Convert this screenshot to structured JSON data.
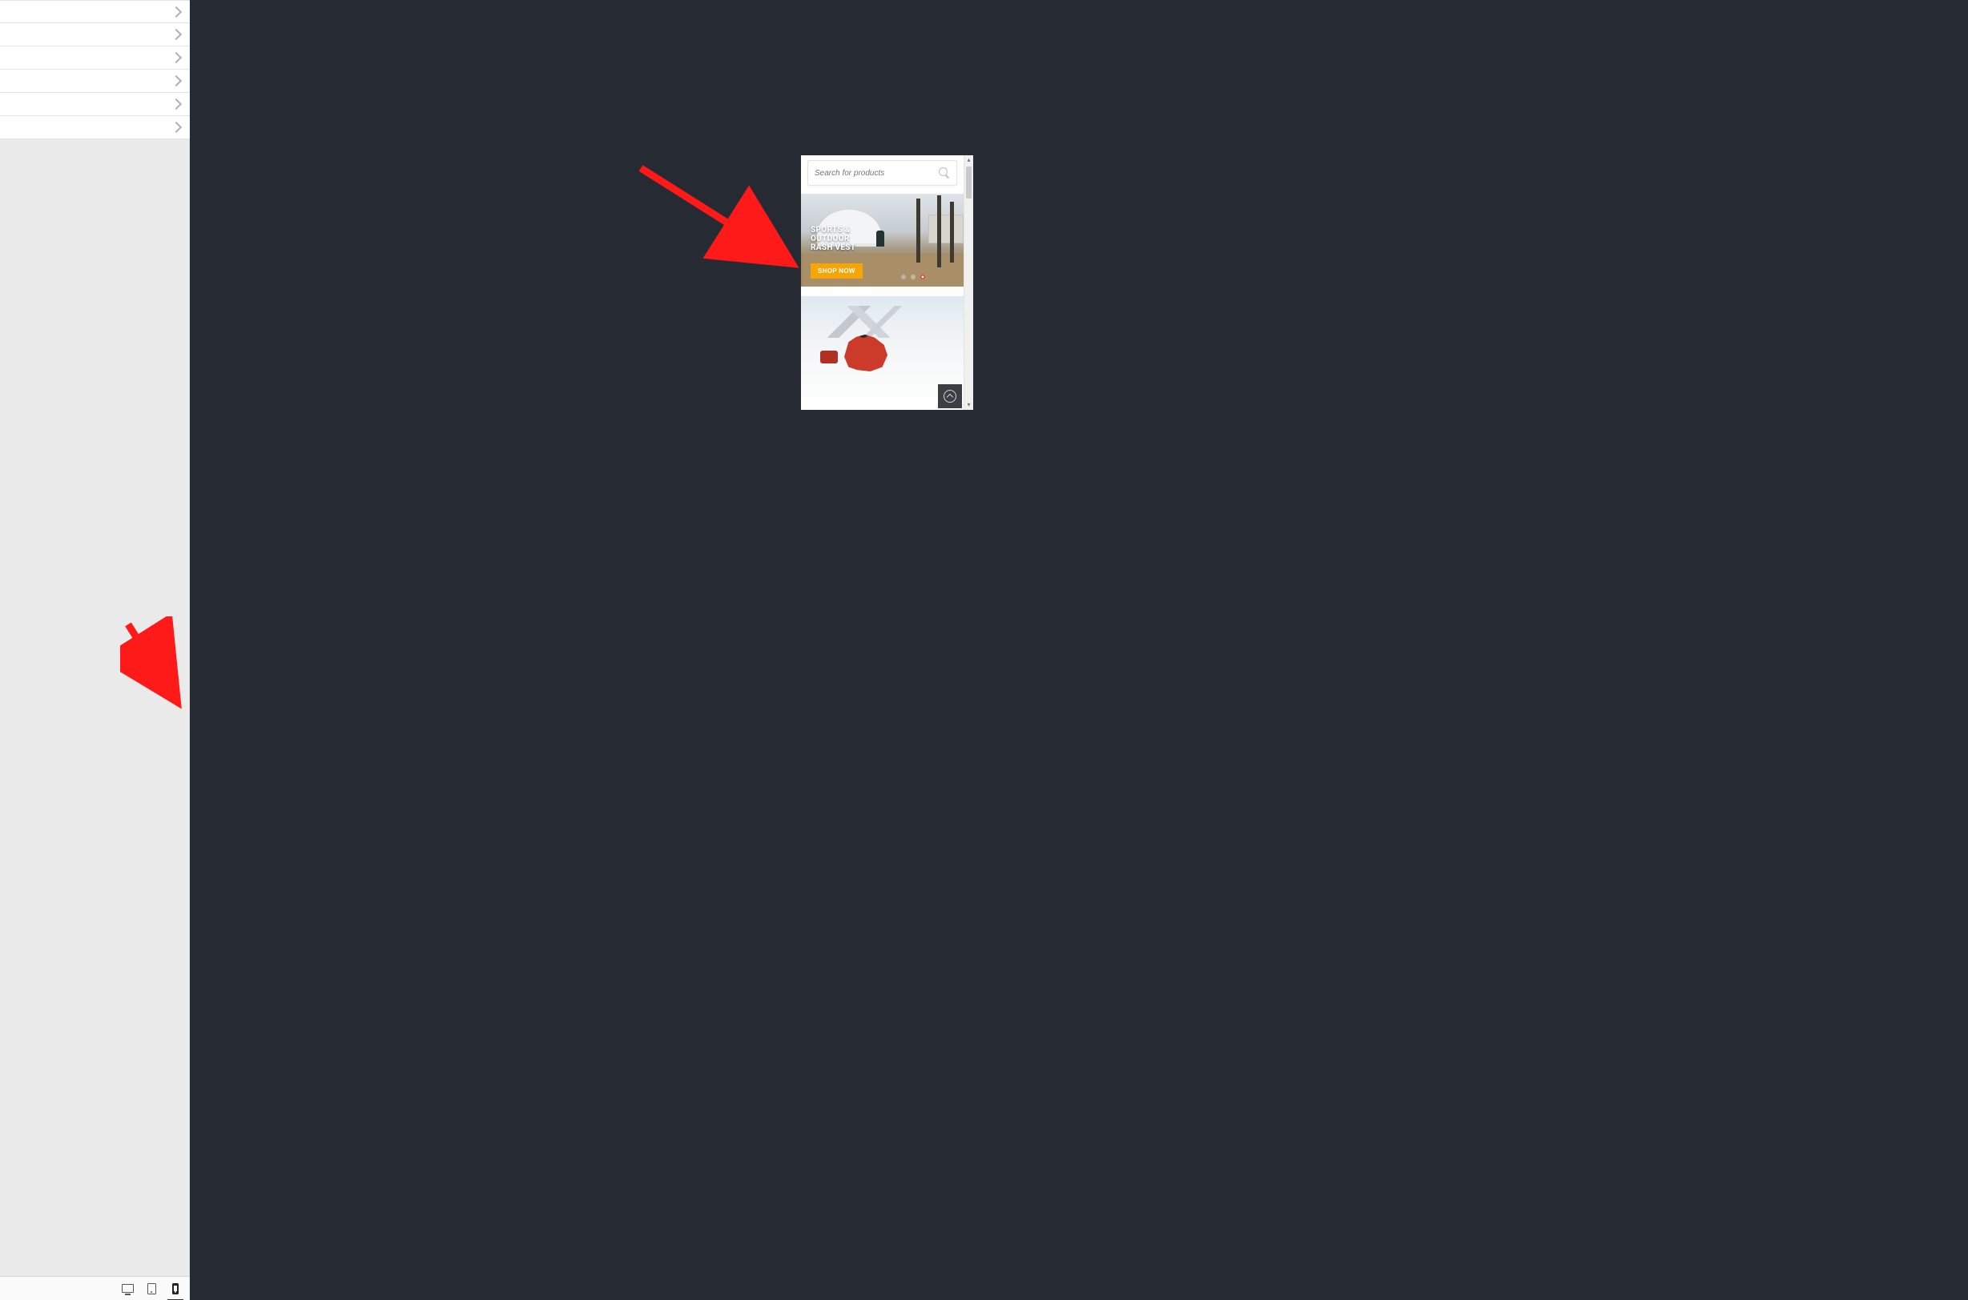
{
  "sidebar": {
    "accordion_item_count": 6
  },
  "device_bar": {
    "desktop_label": "Desktop preview",
    "tablet_label": "Tablet preview",
    "mobile_label": "Mobile preview",
    "active": "mobile"
  },
  "preview": {
    "search": {
      "placeholder": "Search for products"
    },
    "hero": {
      "line1": "SPORTS &",
      "line2": "OUTDOOR",
      "line3": "RASH VEST",
      "subline": "",
      "button": "SHOP NOW",
      "slide_count": 3,
      "active_slide_index": 2
    },
    "scroll_to_top_label": "Back to top"
  },
  "colors": {
    "canvas_bg": "#262b33",
    "accent_button": "#f5a506",
    "sidebar_bg": "#eaeaea",
    "annotation_arrow": "#ff1a1a"
  }
}
